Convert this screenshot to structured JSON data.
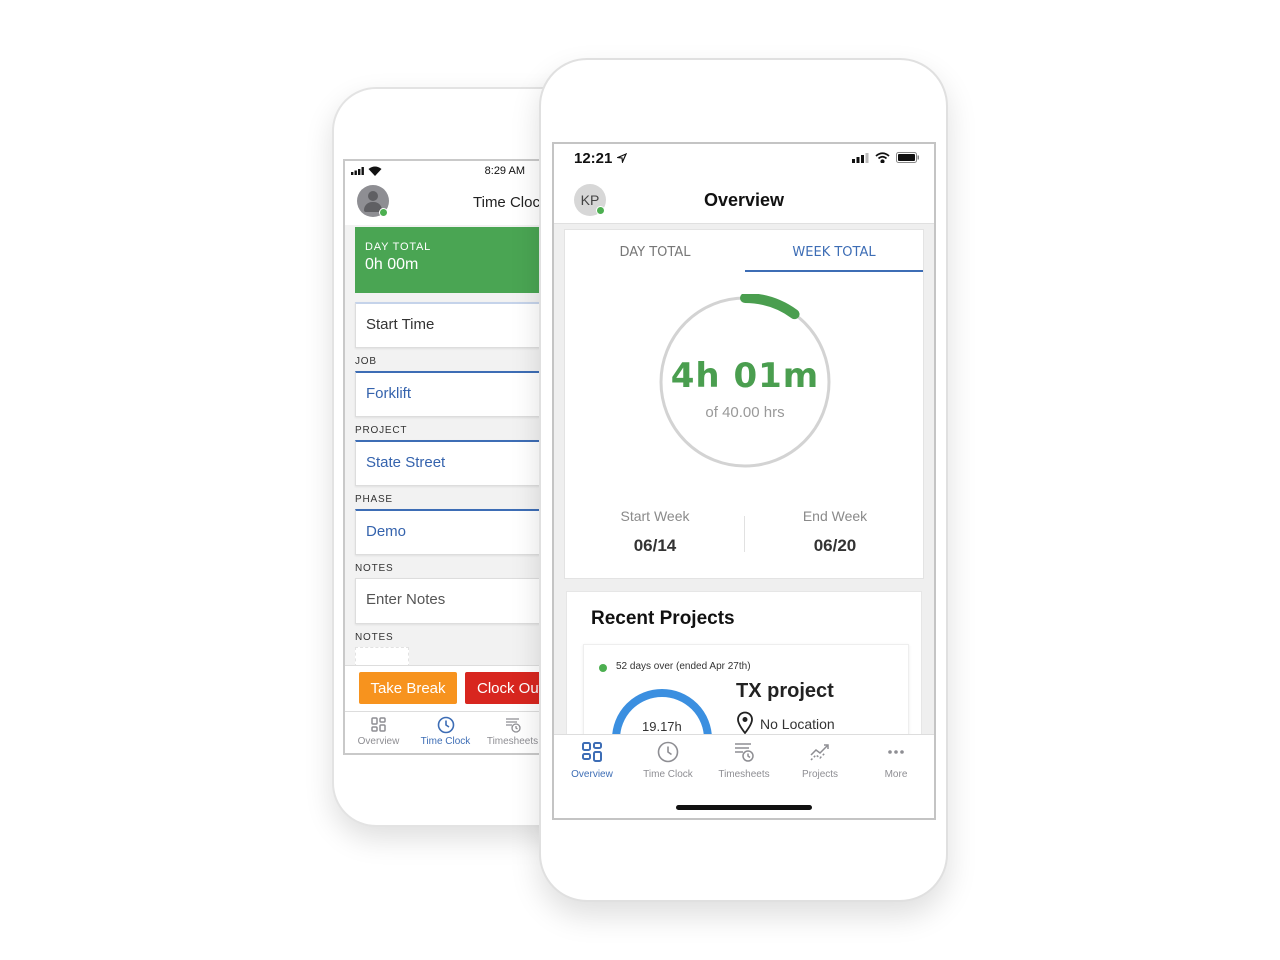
{
  "back_phone": {
    "status": {
      "time": "8:29 AM"
    },
    "header": {
      "title": "Time Clock"
    },
    "day_total": {
      "label": "DAY TOTAL",
      "value": "0h 00m"
    },
    "start_time": {
      "placeholder": "Start Time"
    },
    "fields": [
      {
        "label": "JOB",
        "value": "Forklift"
      },
      {
        "label": "PROJECT",
        "value": "State Street"
      },
      {
        "label": "PHASE",
        "value": "Demo"
      }
    ],
    "notes": {
      "label": "NOTES",
      "placeholder": "Enter Notes"
    },
    "notes2": {
      "label": "NOTES"
    },
    "actions": {
      "take_break": "Take Break",
      "clock_out": "Clock Out"
    },
    "colors": {
      "day_total": "#4aa553",
      "take_break": "#f7931e",
      "clock_out": "#d8261f",
      "accent": "#3d6db5"
    },
    "tabs": [
      {
        "label": "Overview",
        "icon": "grid-icon",
        "active": false
      },
      {
        "label": "Time Clock",
        "icon": "clock-icon",
        "active": true
      },
      {
        "label": "Timesheets",
        "icon": "timesheets-icon",
        "active": false
      }
    ]
  },
  "front_phone": {
    "status": {
      "time": "12:21"
    },
    "header": {
      "avatar_initials": "KP",
      "title": "Overview"
    },
    "totals": {
      "tabs": [
        {
          "label": "DAY TOTAL",
          "active": false
        },
        {
          "label": "WEEK TOTAL",
          "active": true
        }
      ],
      "value": "4h 01m",
      "subtitle": "of 40.00 hrs",
      "progress_fraction": 0.1004,
      "start_week": {
        "label": "Start Week",
        "value": "06/14"
      },
      "end_week": {
        "label": "End Week",
        "value": "06/20"
      }
    },
    "recent": {
      "title": "Recent Projects",
      "projects": [
        {
          "status": "52 days over (ended Apr 27th)",
          "hours": "19.17h",
          "name": "TX  project",
          "location": "No Location"
        }
      ]
    },
    "tabs": [
      {
        "label": "Overview",
        "icon": "grid-icon",
        "active": true
      },
      {
        "label": "Time Clock",
        "icon": "clock-icon",
        "active": false
      },
      {
        "label": "Timesheets",
        "icon": "timesheets-icon",
        "active": false
      },
      {
        "label": "Projects",
        "icon": "trend-icon",
        "active": false
      },
      {
        "label": "More",
        "icon": "more-icon",
        "active": false
      }
    ],
    "colors": {
      "accent": "#3d6db5",
      "ring": "#4a9e4f",
      "gauge": "#3b8fe0"
    }
  }
}
